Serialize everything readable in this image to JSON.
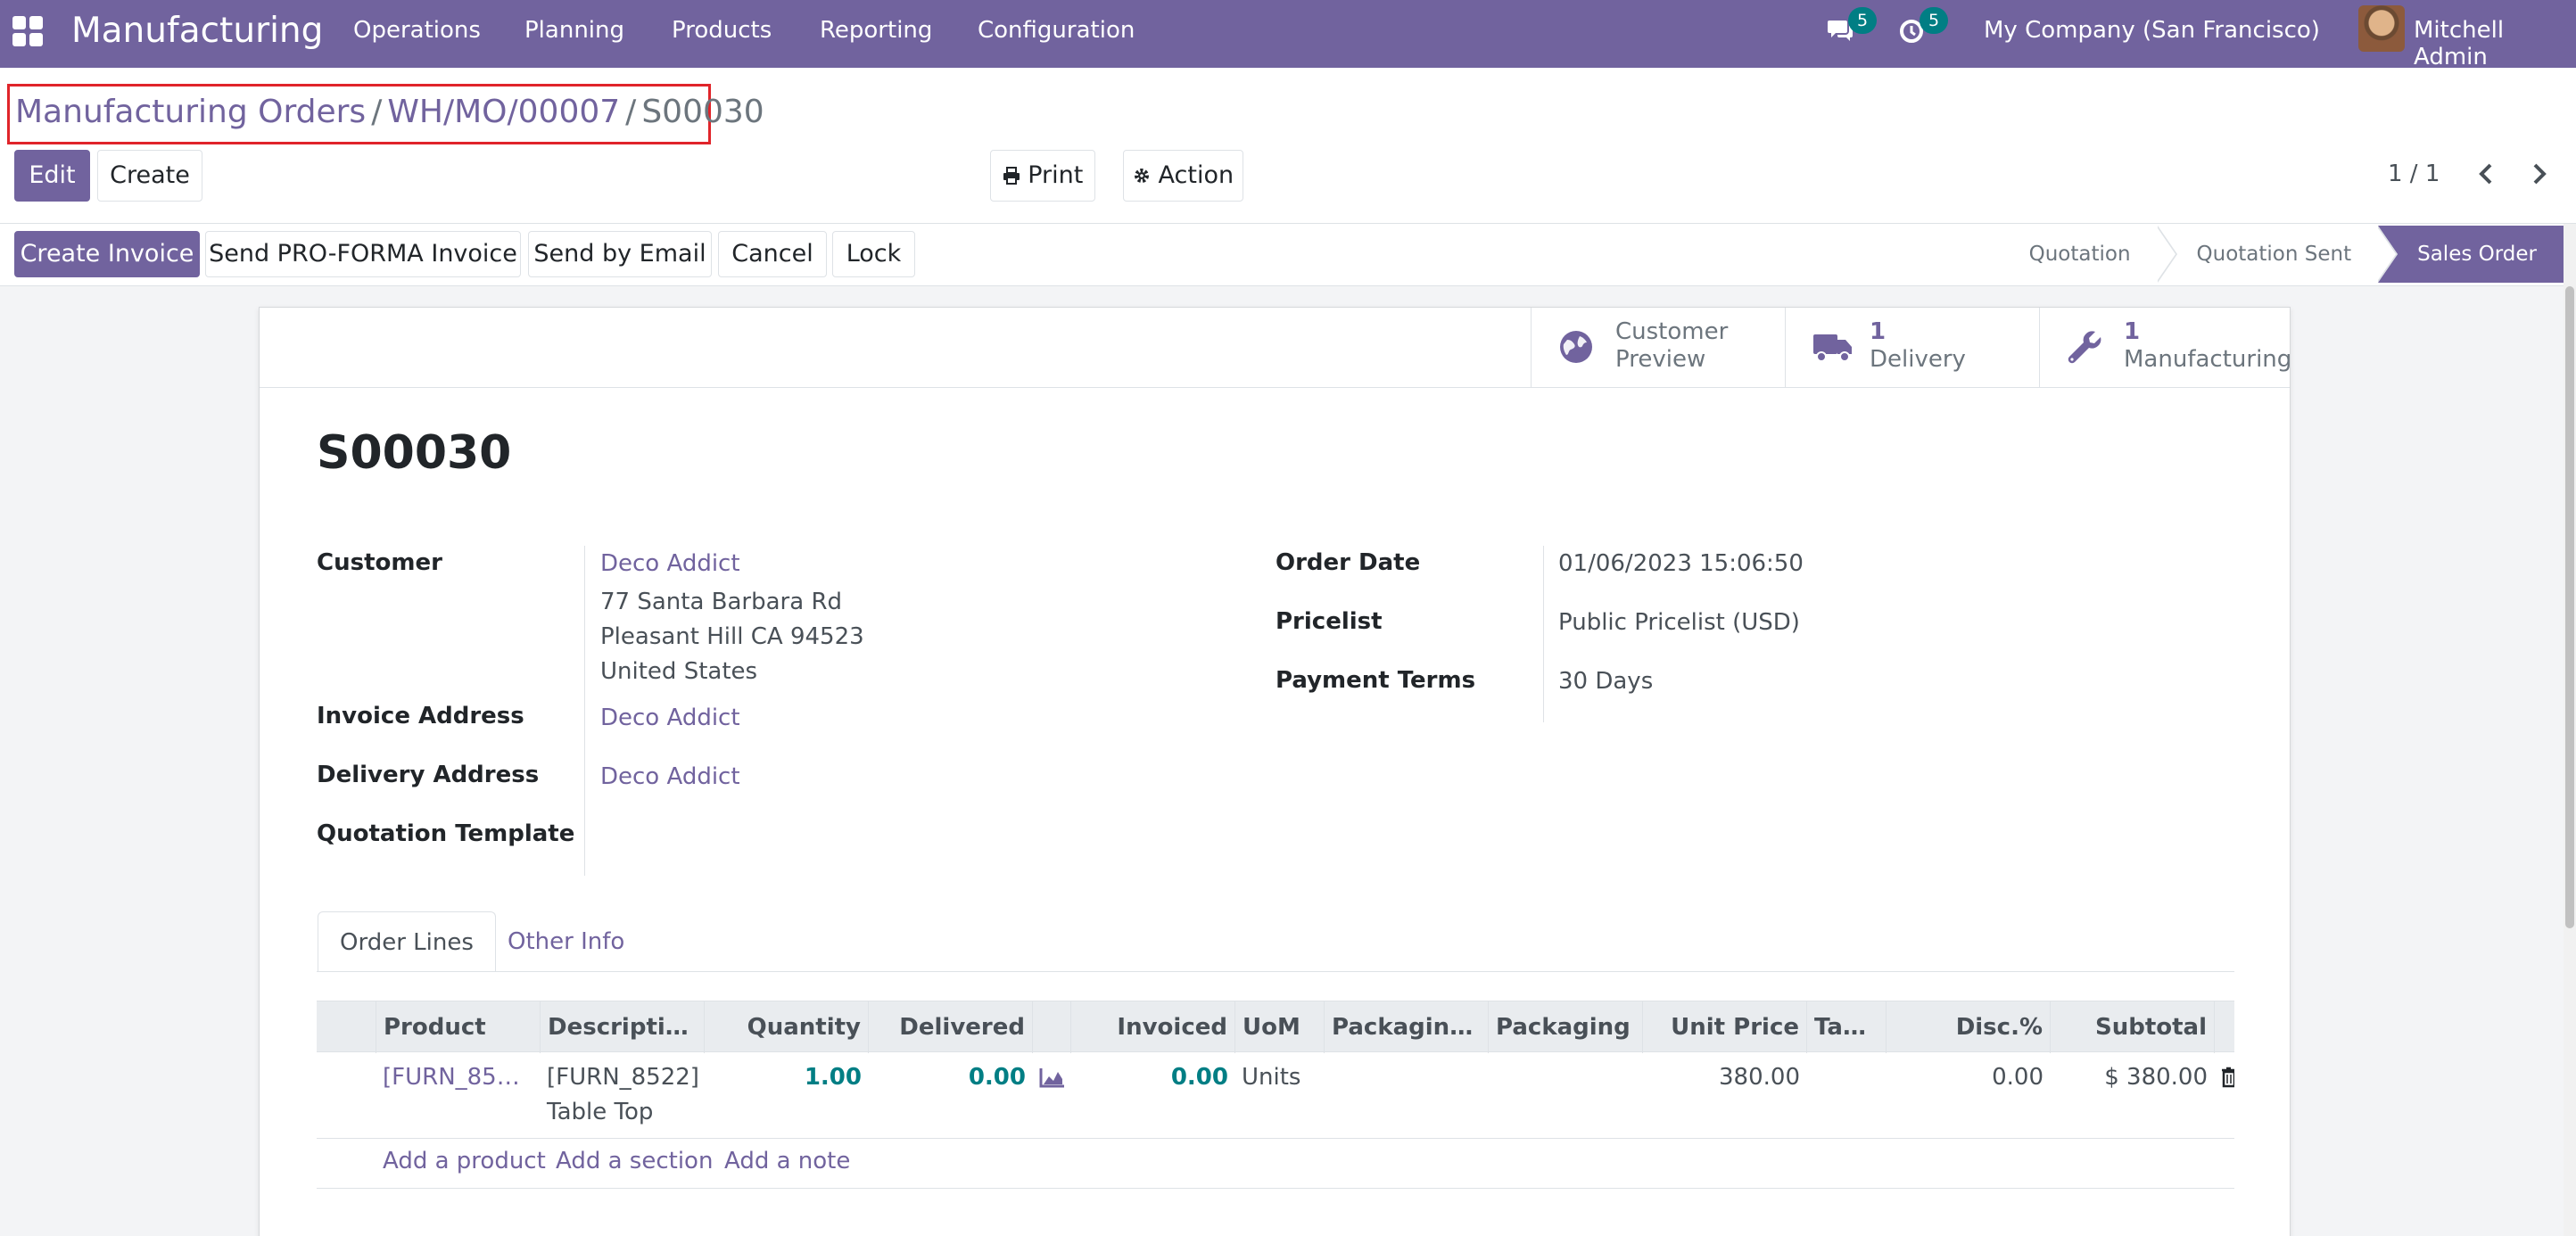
{
  "navbar": {
    "app_name": "Manufacturing",
    "menu": [
      "Operations",
      "Planning",
      "Products",
      "Reporting",
      "Configuration"
    ],
    "messages_count": "5",
    "activities_count": "5",
    "company": "My Company (San Francisco)",
    "user": "Mitchell Admin"
  },
  "breadcrumb": {
    "items": [
      "Manufacturing Orders",
      "WH/MO/00007"
    ],
    "separator": "/",
    "current": "S00030"
  },
  "control": {
    "edit_label": "Edit",
    "create_label": "Create",
    "print_label": "Print",
    "action_label": "Action",
    "pager": "1 / 1"
  },
  "statusbar": {
    "buttons": [
      "Create Invoice",
      "Send PRO-FORMA Invoice",
      "Send by Email",
      "Cancel",
      "Lock"
    ],
    "stages": [
      "Quotation",
      "Quotation Sent",
      "Sales Order"
    ],
    "active_stage": "Sales Order"
  },
  "smart_buttons": {
    "preview": {
      "line1": "Customer",
      "line2": "Preview"
    },
    "delivery": {
      "count": "1",
      "label": "Delivery"
    },
    "manufacturing": {
      "count": "1",
      "label": "Manufacturing"
    }
  },
  "order": {
    "name": "S00030",
    "fields_left": {
      "customer_label": "Customer",
      "customer_name": "Deco Addict",
      "customer_address": [
        "77 Santa Barbara Rd",
        "Pleasant Hill CA 94523",
        "United States"
      ],
      "invoice_address_label": "Invoice Address",
      "invoice_address": "Deco Addict",
      "delivery_address_label": "Delivery Address",
      "delivery_address": "Deco Addict",
      "quotation_template_label": "Quotation Template"
    },
    "fields_right": {
      "order_date_label": "Order Date",
      "order_date": "01/06/2023 15:06:50",
      "pricelist_label": "Pricelist",
      "pricelist": "Public Pricelist (USD)",
      "payment_terms_label": "Payment Terms",
      "payment_terms": "30 Days"
    }
  },
  "tabs": [
    "Order Lines",
    "Other Info"
  ],
  "table": {
    "headers": [
      "Product",
      "Descriptio…",
      "Quantity",
      "Delivered",
      "",
      "Invoiced",
      "UoM",
      "Packaging …",
      "Packaging",
      "Unit Price",
      "Tax…",
      "Disc.%",
      "Subtotal"
    ],
    "rows": [
      {
        "product": "[FURN_852…",
        "description_line1": "[FURN_8522]",
        "description_line2": "Table Top",
        "quantity": "1.00",
        "delivered": "0.00",
        "invoiced": "0.00",
        "uom": "Units",
        "unit_price": "380.00",
        "discount": "0.00",
        "subtotal": "$ 380.00"
      }
    ],
    "add_links": [
      "Add a product",
      "Add a section",
      "Add a note"
    ]
  },
  "colors": {
    "brand": "#71639e",
    "badge": "#017e84",
    "highlight_box": "#e0242a",
    "numeric_link": "#017e84"
  }
}
